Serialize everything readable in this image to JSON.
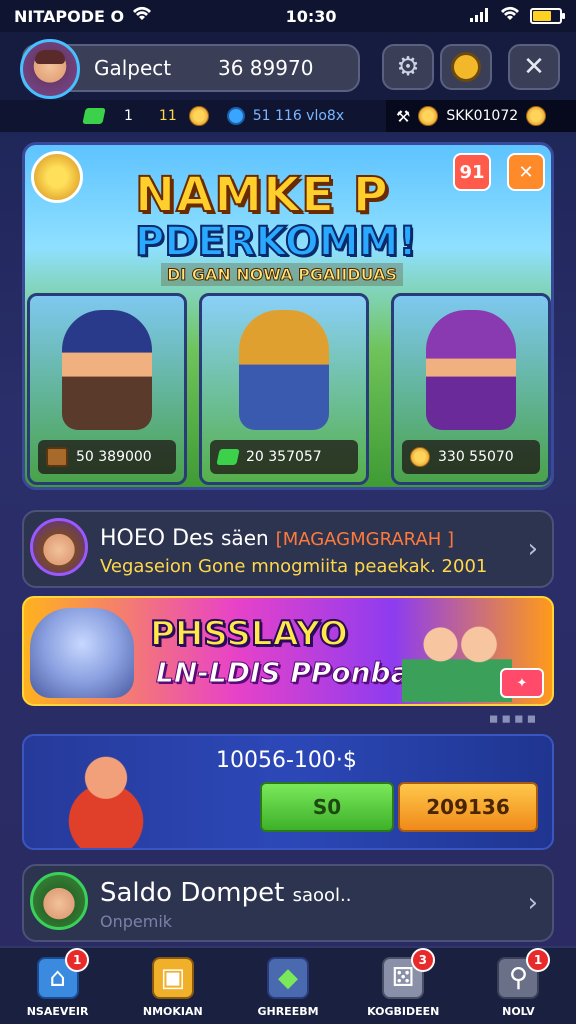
{
  "status_bar": {
    "carrier": "NITAPODE O",
    "time": "10:30"
  },
  "header": {
    "profile_name": "Galpect",
    "profile_coins": "36 89970"
  },
  "currency": {
    "gem_a": "1",
    "gem_b": "11",
    "blue_value": "51 116 vlo8x",
    "gold_value": "SKK01072"
  },
  "hero": {
    "title_line1": "NAMKE P",
    "title_line2": "PDERKOMM!",
    "subtitle": "DI GAN NOWA PGAIIDUAS",
    "badge_red": "91",
    "cards": [
      {
        "value": "50 389000"
      },
      {
        "value": "20 357057"
      },
      {
        "value": "330 55070"
      }
    ]
  },
  "news": {
    "title": "HOEO Des",
    "title_extra": "säen",
    "tag": "[MAGAGMGRARAH ]",
    "subtitle": "Vegaseion Gone mnogmiita peaekak. 2001"
  },
  "promo": {
    "title": "PHSSLAYO",
    "subtitle": "LN-LDIS PPonbail!"
  },
  "offer": {
    "price": "10056-100·$",
    "btn_green": "S0",
    "btn_orange": "209136"
  },
  "wallet": {
    "title": "Saldo Dompet",
    "title_extra": "saool..",
    "subtitle": "Onpemik"
  },
  "nav": [
    {
      "label": "NSAEVEIR",
      "badge": "1",
      "icon": "home-icon"
    },
    {
      "label": "NMOKIAN",
      "badge": "",
      "icon": "shop-icon"
    },
    {
      "label": "GHREEBM",
      "badge": "",
      "icon": "gem-chest-icon"
    },
    {
      "label": "KOGBIDEEN",
      "badge": "3",
      "icon": "dice-icon"
    },
    {
      "label": "NOLV",
      "badge": "1",
      "icon": "search-icon"
    }
  ]
}
